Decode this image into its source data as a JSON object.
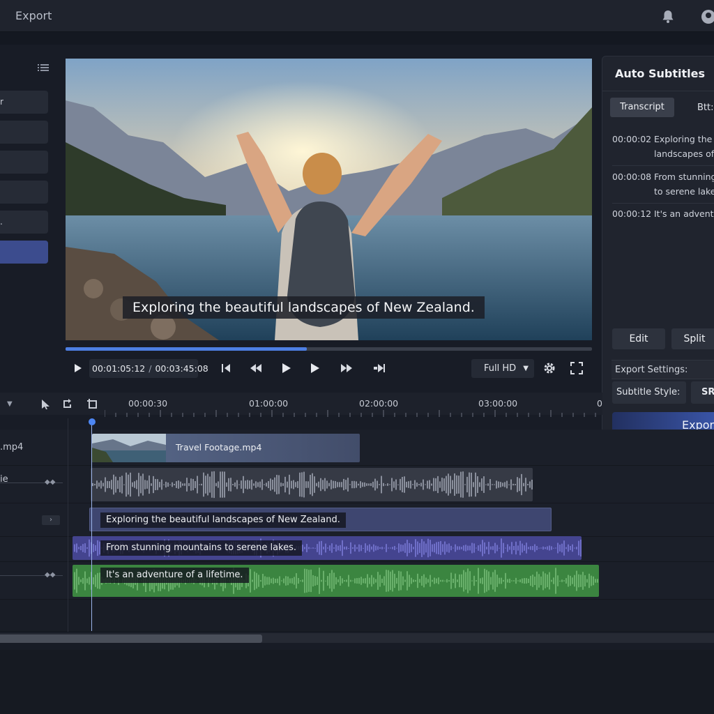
{
  "topbar": {
    "title": "Export"
  },
  "left_panel": {
    "items": [
      {
        "label": "r"
      },
      {
        "label": ""
      },
      {
        "label": ""
      },
      {
        "label": ""
      },
      {
        "label": "."
      },
      {
        "label": "",
        "active": true
      }
    ]
  },
  "preview": {
    "caption": "Exploring the beautiful landscapes of New Zealand.",
    "progress": 0.458
  },
  "transport": {
    "current_time": "00:01:05:12",
    "separator": "/",
    "total_time": "00:03:45:08",
    "quality": "Full HD"
  },
  "right_panel": {
    "title": "Auto Subtitles",
    "tabs": [
      "Transcript",
      "Btt:"
    ],
    "transcript": [
      {
        "time": "00:00:02",
        "line1": "Exploring the l",
        "line2": "landscapes of"
      },
      {
        "time": "00:00:08",
        "line1": "From stunning",
        "line2": "to serene lakes"
      },
      {
        "time": "00:00:12",
        "line1": "It's an adventu",
        "line2": ""
      }
    ],
    "edit_label": "Edit",
    "split_label": "Split",
    "export_settings_label": "Export Settings:",
    "subtitle_style_label": "Subtitle Style:",
    "subtitle_style_value": "SR",
    "export_label": "Export"
  },
  "timeline": {
    "ruler": [
      "00:00:30",
      "01:00:00",
      "02:00:00",
      "03:00:00",
      "0"
    ],
    "tracks": [
      {
        "name": ".mp4"
      },
      {
        "name": "ie"
      },
      {
        "name": ""
      },
      {
        "name": ""
      },
      {
        "name": ""
      }
    ],
    "video_clip_name": "Travel Footage.mp4",
    "subtitle_clips": [
      "Exploring the beautiful landscapes of New Zealand.",
      "From stunning mountains to serene lakes.",
      "It's an adventure of a lifetime."
    ]
  },
  "colors": {
    "accent": "#4d7fe3",
    "subtitle_track_1": "#4a5585",
    "subtitle_track_2": "#4b4aa0",
    "subtitle_track_3": "#3f8a3f"
  },
  "icons": [
    "bell-icon",
    "avatar-icon",
    "list-icon",
    "play-icon",
    "skip-start-icon",
    "rewind-icon",
    "play-icon",
    "play-alt-icon",
    "fast-forward-icon",
    "skip-end-icon",
    "gear-icon",
    "fullscreen-icon",
    "select-tool-icon",
    "loop-icon",
    "crop-icon"
  ]
}
